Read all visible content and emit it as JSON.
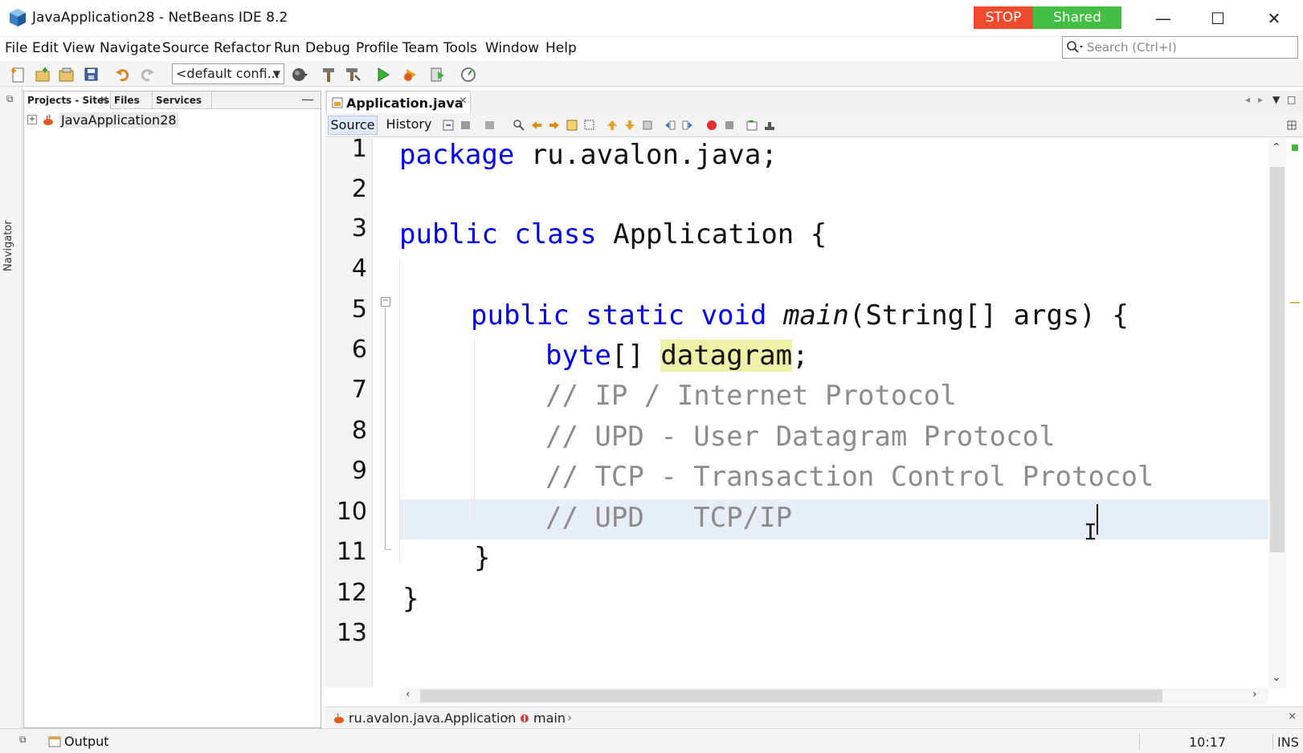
{
  "window": {
    "title": "JavaApplication28 - NetBeans IDE 8.2",
    "stop_label": "STOP",
    "shared_label": "Shared",
    "minimize": "—",
    "maximize": "☐",
    "close": "✕"
  },
  "menu": [
    "File",
    "Edit",
    "View",
    "Navigate",
    "Source",
    "Refactor",
    "Run",
    "Debug",
    "Profile",
    "Team",
    "Tools",
    "Window",
    "Help"
  ],
  "search": {
    "placeholder": "Search (Ctrl+I)"
  },
  "toolbar": {
    "config_value": "<default confi..."
  },
  "side": {
    "navigator_label": "Navigator"
  },
  "projects": {
    "tabs": [
      "Projects - Sites",
      "Files",
      "Services"
    ],
    "close_glyph": "×",
    "minimize_glyph": "—",
    "tree_expander": "+",
    "tree_root": "JavaApplication28"
  },
  "editor": {
    "tab_label": "Application.java",
    "tab_close": "×",
    "source_label": "Source",
    "history_label": "History",
    "line_numbers": [
      "1",
      "2",
      "3",
      "4",
      "5",
      "6",
      "7",
      "8",
      "9",
      "10",
      "11",
      "12",
      "13"
    ],
    "code": {
      "l1_kw": "package",
      "l1_rest": " ru.avalon.java;",
      "l3_kw": "public class",
      "l3_rest": " Application {",
      "l5_kw": "public static void",
      "l5_method": "main",
      "l5_rest": "(String[] args) {",
      "l6_kw": "byte",
      "l6_br": "[] ",
      "l6_var": "datagram",
      "l6_end": ";",
      "l7": "// IP / Internet Protocol",
      "l8": "// UPD - User Datagram Protocol",
      "l9": "// TCP - Transaction Control Protocol",
      "l10": "// UPD   TCP/IP",
      "l11": "}",
      "l12": "}"
    },
    "ibeam": "I",
    "breadcrumb": [
      "ru.avalon.java.Application",
      "main"
    ],
    "breadcrumb_sep": "›",
    "breadcrumb_close": "×"
  },
  "status": {
    "output_label": "Output",
    "position": "10:17",
    "mode": "INS"
  },
  "colors": {
    "keyword": "#0000e6",
    "comment": "#8c8c8c",
    "stop": "#ee4a2c",
    "shared": "#43c043",
    "current_line": "#e8eef8",
    "mark_occurrence": "#eef2a8"
  }
}
